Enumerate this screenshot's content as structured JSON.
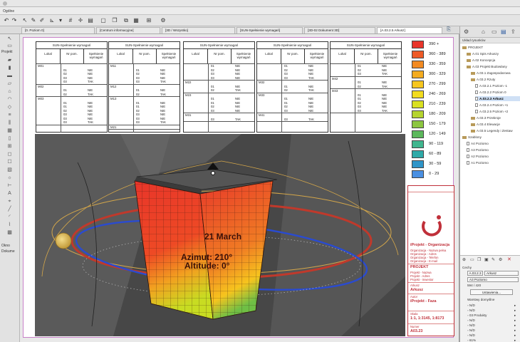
{
  "menubar": {
    "items": [
      "Ogólne"
    ]
  },
  "view_tabs": [
    {
      "label": "[0. Poziom 0]"
    },
    {
      "label": "[Centrum informacyjne]"
    },
    {
      "label": "[3D / Wszystko]"
    },
    {
      "label": "[SUN-Spełnienie wymagań]"
    },
    {
      "label": "[3D-02 Dokument 3D]"
    },
    {
      "label": "[A.03.2.5 Arkusz]"
    }
  ],
  "left_panel": {
    "projekt_label": "Projekt",
    "okno_label": "Okno",
    "dokumentacja_label": "Dokume"
  },
  "sheet": {
    "tables": [
      {
        "title": "SUN-Spełnienie wymagań",
        "headers": [
          "Lokal",
          "Nr pom.",
          "Spełnienie wymagań"
        ],
        "groups": [
          {
            "lokal": "M01",
            "rows": [
              [
                "01",
                "NIE"
              ],
              [
                "02",
                "NIE"
              ],
              [
                "03",
                "NIE"
              ],
              [
                "03",
                "TAK"
              ]
            ]
          },
          {
            "lokal": "M02",
            "rows": [
              [
                "01",
                "NIE"
              ],
              [
                "02",
                "TAK"
              ]
            ]
          },
          {
            "lokal": "M03",
            "rows": [
              [
                "01",
                "NIE"
              ],
              [
                "01",
                "NIE"
              ],
              [
                "02",
                "NIE"
              ],
              [
                "03",
                "NIE"
              ],
              [
                "03",
                "NIE"
              ],
              [
                "03",
                "TAK"
              ]
            ]
          }
        ]
      },
      {
        "title": "SUN-Spełnienie wymagań",
        "headers": [
          "Lokal",
          "Nr pom.",
          "Spełnienie wymagań"
        ],
        "groups": [
          {
            "lokal": "M11",
            "rows": [
              [
                "01",
                "NIE"
              ],
              [
                "02",
                "NIE"
              ],
              [
                "03",
                "NIE"
              ],
              [
                "03",
                "TAK"
              ]
            ]
          },
          {
            "lokal": "M12",
            "rows": [
              [
                "01",
                "NIE"
              ],
              [
                "02",
                "TAK"
              ]
            ]
          },
          {
            "lokal": "M13",
            "rows": [
              [
                "01",
                "NIE"
              ],
              [
                "01",
                "NIE"
              ],
              [
                "02",
                "NIE"
              ],
              [
                "03",
                "NIE"
              ],
              [
                "03",
                "NIE"
              ],
              [
                "03",
                "TAK"
              ]
            ]
          },
          {
            "lokal": "M21",
            "rows": []
          }
        ]
      },
      {
        "title": "SUN-Spełnienie wymagań",
        "headers": [
          "Lokal",
          "Nr pom.",
          "Spełnienie wymagań"
        ],
        "groups": [
          {
            "lokal": "",
            "rows": [
              [
                "01",
                "NIE"
              ],
              [
                "02",
                "NIE"
              ],
              [
                "03",
                "NIE"
              ],
              [
                "03",
                "NIE"
              ]
            ]
          },
          {
            "lokal": "M22",
            "rows": [
              [
                "01",
                "NIE"
              ],
              [
                "02",
                "TAK"
              ]
            ]
          },
          {
            "lokal": "M23",
            "rows": [
              [
                "01",
                "NIE"
              ],
              [
                "01",
                "NIE"
              ],
              [
                "02",
                "NIE"
              ],
              [
                "03",
                "NIE"
              ]
            ]
          },
          {
            "lokal": "M31",
            "rows": [
              [
                "03",
                "TAK"
              ]
            ]
          }
        ]
      },
      {
        "title": "SUN-Spełnienie wymagań",
        "headers": [
          "Lokal",
          "Nr pom.",
          "Spełnienie wymagań"
        ],
        "groups": [
          {
            "lokal": "",
            "rows": [
              [
                "01",
                "NIE"
              ],
              [
                "02",
                "NIE"
              ],
              [
                "03",
                "NIE"
              ],
              [
                "03",
                "TAK"
              ]
            ]
          },
          {
            "lokal": "M32",
            "rows": [
              [
                "01",
                "NIE"
              ],
              [
                "02",
                "TAK"
              ]
            ]
          },
          {
            "lokal": "M33",
            "rows": [
              [
                "01",
                "NIE"
              ],
              [
                "01",
                "NIE"
              ],
              [
                "02",
                "NIE"
              ],
              [
                "03",
                "NIE"
              ]
            ]
          },
          {
            "lokal": "M41",
            "rows": [
              [
                "03",
                "TAK"
              ]
            ]
          }
        ]
      },
      {
        "title": "SUN-Spełnienie wymagań",
        "headers": [
          "Lokal",
          "Nr pom.",
          "Spełnienie wymagań"
        ],
        "groups": [
          {
            "lokal": "",
            "rows": [
              [
                "01",
                "NIE"
              ],
              [
                "02",
                "NIE"
              ],
              [
                "03",
                "TAK"
              ]
            ]
          },
          {
            "lokal": "M42",
            "rows": [
              [
                "01",
                "NIE"
              ],
              [
                "02",
                "TAK"
              ]
            ]
          },
          {
            "lokal": "M43",
            "rows": [
              [
                "01",
                "NIE"
              ],
              [
                "01",
                "NIE"
              ],
              [
                "02",
                "NIE"
              ],
              [
                "03",
                "NIE"
              ],
              [
                "03",
                "TAK"
              ]
            ]
          }
        ]
      }
    ],
    "legend": [
      {
        "label": "390 +",
        "color": "#e8352a"
      },
      {
        "label": "360 - 389",
        "color": "#ee5a26"
      },
      {
        "label": "330 - 359",
        "color": "#f28a22"
      },
      {
        "label": "300 - 329",
        "color": "#f4ac20"
      },
      {
        "label": "270 - 299",
        "color": "#f6c61e"
      },
      {
        "label": "240 - 269",
        "color": "#f2dc1e"
      },
      {
        "label": "210 - 239",
        "color": "#d9e021"
      },
      {
        "label": "180 - 209",
        "color": "#b5d42e"
      },
      {
        "label": "150 - 179",
        "color": "#8cc63f"
      },
      {
        "label": "120 - 149",
        "color": "#5cb85c"
      },
      {
        "label": "90 - 119",
        "color": "#3fb68e"
      },
      {
        "label": "60 - 89",
        "color": "#2eaaa8"
      },
      {
        "label": "30 - 59",
        "color": "#2f95c8"
      },
      {
        "label": "0 - 29",
        "color": "#4a90e2"
      }
    ],
    "render": {
      "date_label": "21 March",
      "azimut_label": "Azimut: 210°",
      "altitude_label": "Altitude: 0°"
    },
    "titleblock": {
      "company": "iProjekt - Organizacja",
      "company_lines": [
        "Organizacja - Nazwa pełna",
        "Organizacja - Adres",
        "Organizacja - Telefon",
        "Organizacja - E-mail"
      ],
      "project_label": "PROJEKT",
      "project_lines": [
        "Projekt - Nazwa",
        "Projekt - Adres",
        "Projekt - Inwestor"
      ],
      "sheet_name_label": "Arkusz",
      "sheet_name": "Arkusz",
      "owner_label": "Autor",
      "owner": "iProjekt - Faza",
      "scale_label": "Skala",
      "scale": "1:1, 1:3145, 1:8173",
      "number_label": "Numer",
      "number": "A03.23"
    },
    "accent": "#c0303a"
  },
  "navigator": {
    "header": "Układ rysunków",
    "items": [
      {
        "label": "PROJEKT",
        "indent": 0,
        "icon": "folder"
      },
      {
        "label": "A.01 Spis Arkuszy",
        "indent": 1,
        "icon": "folder"
      },
      {
        "label": "A.02 Koncepcja",
        "indent": 1,
        "icon": "folder"
      },
      {
        "label": "A.03 Projekt Budowlany",
        "indent": 1,
        "icon": "folder"
      },
      {
        "label": "A.03.1 Zagospodarowa",
        "indent": 2,
        "icon": "folder"
      },
      {
        "label": "A.03.2 Rzuty",
        "indent": 2,
        "icon": "folder"
      },
      {
        "label": "A.03.2.1 Poziom -1",
        "indent": 3,
        "icon": "page"
      },
      {
        "label": "A.03.2.2 Poziom 0",
        "indent": 3,
        "icon": "page"
      },
      {
        "label": "A.03.2.3 Arkusz",
        "indent": 3,
        "icon": "page",
        "selected": true
      },
      {
        "label": "A.03.2.4 Poziom +1",
        "indent": 3,
        "icon": "page"
      },
      {
        "label": "A.03.2.5 Poziom +2",
        "indent": 3,
        "icon": "page"
      },
      {
        "label": "A.03.3 Przekroje",
        "indent": 2,
        "icon": "folder"
      },
      {
        "label": "A.03.4 Elewacje",
        "indent": 2,
        "icon": "folder"
      },
      {
        "label": "A.03.5 Legendy i Zestaw",
        "indent": 2,
        "icon": "folder"
      },
      {
        "label": "Szablony",
        "indent": 0,
        "icon": "folder"
      },
      {
        "label": "A4 Poziomo",
        "indent": 1,
        "icon": "page"
      },
      {
        "label": "A3 Poziomo",
        "indent": 1,
        "icon": "page"
      },
      {
        "label": "A2 Poziomo",
        "indent": 1,
        "icon": "page"
      },
      {
        "label": "A1 Poziomo",
        "indent": 1,
        "icon": "page"
      }
    ]
  },
  "properties": {
    "cechy_label": "Cechy",
    "id_value": "A.03.2.3",
    "name_value": "Arkusz",
    "template_value": "A3 Poziomo",
    "size_value": "594 / 420",
    "settings_button": "Ustawienia...",
    "layers_label": "Warstwy domyślne",
    "rows": [
      "N/D",
      "N/D",
      "03 Produkty",
      "N/D",
      "N/D",
      "N/D",
      "N/D",
      "61%"
    ]
  }
}
